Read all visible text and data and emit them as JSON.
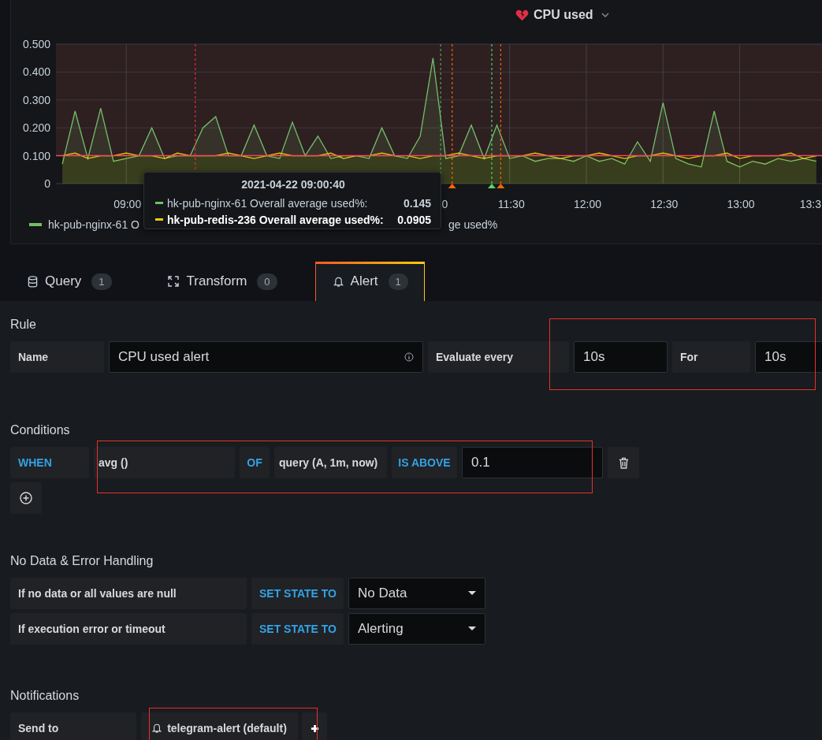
{
  "panel": {
    "title": "CPU used",
    "chart_data": {
      "type": "area",
      "grid": true,
      "categories": [
        null,
        null,
        null,
        null,
        null,
        "09:00",
        null,
        null,
        null,
        null,
        null,
        null,
        null,
        null,
        null,
        null,
        null,
        null,
        null,
        null,
        null,
        null,
        null,
        null,
        null,
        null,
        null,
        null,
        null,
        null,
        null,
        null,
        null,
        null,
        null,
        "11:30",
        null,
        null,
        null,
        null,
        null,
        "12:00",
        null,
        null,
        null,
        null,
        null,
        "12:30",
        null,
        null,
        null,
        null,
        null,
        "13:00",
        null,
        null,
        null,
        null,
        null,
        null
      ],
      "series": [
        {
          "color": "#73bf69",
          "values": [
            0.07,
            0.26,
            0.09,
            0.27,
            0.08,
            0.09,
            0.1,
            0.2,
            0.09,
            0.1,
            0.1,
            0.2,
            0.24,
            0.1,
            0.1,
            0.21,
            0.1,
            0.09,
            0.22,
            0.1,
            0.17,
            0.09,
            0.1,
            0.1,
            0.09,
            0.2,
            0.1,
            0.09,
            0.17,
            0.45,
            0.09,
            0.1,
            0.21,
            0.09,
            0.21,
            0.09,
            0.1,
            0.08,
            0.09,
            0.09,
            0.08,
            0.1,
            0.08,
            0.09,
            0.07,
            0.15,
            0.08,
            0.29,
            0.09,
            0.07,
            0.06,
            0.26,
            0.08,
            0.06,
            0.08,
            0.07,
            0.09,
            0.08,
            0.09,
            0.08
          ]
        },
        {
          "color": "#f2cc0c",
          "values": [
            0.1,
            0.11,
            0.09,
            0.1,
            0.1,
            0.11,
            0.1,
            0.1,
            0.09,
            0.11,
            0.1,
            0.1,
            0.1,
            0.11,
            0.1,
            0.09,
            0.1,
            0.11,
            0.1,
            0.1,
            0.1,
            0.11,
            0.09,
            0.1,
            0.1,
            0.11,
            0.1,
            0.1,
            0.09,
            0.1,
            0.1,
            0.11,
            0.1,
            0.09,
            0.1,
            0.1,
            0.1,
            0.11,
            0.1,
            0.09,
            0.1,
            0.1,
            0.11,
            0.1,
            0.09,
            0.1,
            0.1,
            0.11,
            0.1,
            0.09,
            0.1,
            0.1,
            0.11,
            0.09,
            0.1,
            0.1,
            0.1,
            0.11,
            0.09,
            0.1
          ]
        }
      ],
      "ylim": [
        0,
        0.5
      ],
      "yticks": [
        {
          "value": 0,
          "label": "0"
        },
        {
          "value": 0.1,
          "label": "0.100"
        },
        {
          "value": 0.2,
          "label": "0.200"
        },
        {
          "value": 0.3,
          "label": "0.300"
        },
        {
          "value": 0.4,
          "label": "0.400"
        },
        {
          "value": 0.5,
          "label": "0.500"
        }
      ],
      "bands": [
        {
          "axis": "y",
          "from": 0.1,
          "to": 0.5,
          "color": "#2e1f21"
        }
      ],
      "ref_lines": [
        {
          "axis": "y",
          "value": 0.1,
          "color": "#f2495c"
        }
      ]
    },
    "x_axis_label_fragments": [
      "0",
      "13:3"
    ],
    "legend": [
      {
        "label": "hk-pub-nginx-61 O",
        "color": "#73bf69"
      },
      {
        "label": "ge used%"
      }
    ],
    "tooltip": {
      "time": "2021-04-22 09:00:40",
      "rows": [
        {
          "label": "hk-pub-nginx-61 Overall average used%:",
          "value": "0.145",
          "color": "#73bf69",
          "emphasized": false
        },
        {
          "label": "hk-pub-redis-236 Overall average used%:",
          "value": "0.0905",
          "color": "#f2cc0c",
          "emphasized": true
        }
      ]
    }
  },
  "tabs": [
    {
      "label": "Query",
      "count": "1",
      "kind": "query",
      "selected": false
    },
    {
      "label": "Transform",
      "count": "0",
      "kind": "transform",
      "selected": false
    },
    {
      "label": "Alert",
      "count": "1",
      "kind": "alert",
      "selected": true
    }
  ],
  "rule": {
    "title": "Rule",
    "name_label": "Name",
    "name_value": "CPU used alert",
    "evaluate_label": "Evaluate every",
    "evaluate_value": "10s",
    "for_label": "For",
    "for_value": "10s",
    "highlighted": true
  },
  "conditions": {
    "title": "Conditions",
    "when": "WHEN",
    "reducer": "avg ()",
    "of": "OF",
    "query": "query (A, 1m, now)",
    "evaluator": "IS ABOVE",
    "threshold": "0.1",
    "highlighted": true
  },
  "no_data": {
    "title": "No Data & Error Handling",
    "rows": [
      {
        "label": "If no data or all values are null",
        "action": "SET STATE TO",
        "value": "No Data"
      },
      {
        "label": "If execution error or timeout",
        "action": "SET STATE TO",
        "value": "Alerting"
      }
    ]
  },
  "notifications": {
    "title": "Notifications",
    "send_to_label": "Send to",
    "channels": [
      {
        "label": "telegram-alert (default)",
        "highlighted": true
      }
    ]
  }
}
